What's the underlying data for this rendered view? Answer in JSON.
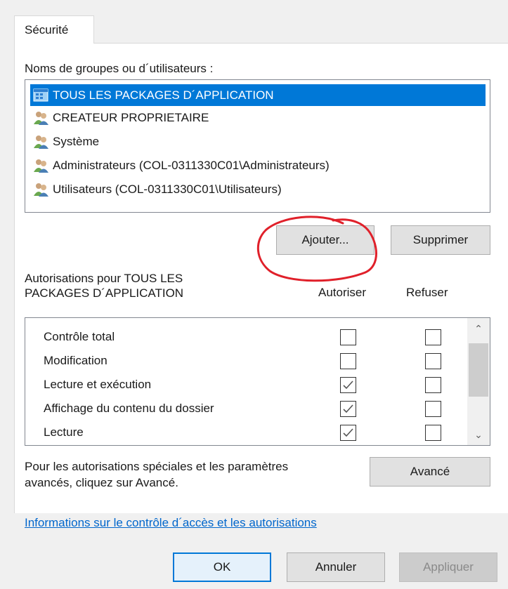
{
  "tab": {
    "label": "Sécurité"
  },
  "users": {
    "label": "Noms de groupes ou d´utilisateurs :",
    "items": [
      {
        "name": "TOUS LES PACKAGES D´APPLICATION",
        "icon": "app-package-icon",
        "selected": true
      },
      {
        "name": "CREATEUR PROPRIETAIRE",
        "icon": "user-group-icon",
        "selected": false
      },
      {
        "name": "Système",
        "icon": "user-group-icon",
        "selected": false
      },
      {
        "name": "Administrateurs (COL-0311330C01\\Administrateurs)",
        "icon": "user-group-icon",
        "selected": false
      },
      {
        "name": "Utilisateurs (COL-0311330C01\\Utilisateurs)",
        "icon": "user-group-icon",
        "selected": false
      }
    ],
    "add_label": "Ajouter...",
    "remove_label": "Supprimer"
  },
  "permissions": {
    "title_line1": "Autorisations pour TOUS LES",
    "title_line2": "PACKAGES D´APPLICATION",
    "allow_header": "Autoriser",
    "deny_header": "Refuser",
    "rows": [
      {
        "name": "Contrôle total",
        "allow": false,
        "deny": false
      },
      {
        "name": "Modification",
        "allow": false,
        "deny": false
      },
      {
        "name": "Lecture et exécution",
        "allow": true,
        "deny": false
      },
      {
        "name": "Affichage du contenu du dossier",
        "allow": true,
        "deny": false
      },
      {
        "name": "Lecture",
        "allow": true,
        "deny": false
      }
    ]
  },
  "advanced": {
    "text_line1": "Pour les autorisations spéciales et les paramètres",
    "text_line2": "avancés, cliquez sur Avancé.",
    "button_label": "Avancé"
  },
  "link": {
    "text": "Informations sur le contrôle d´accès et les autorisations"
  },
  "footer": {
    "ok_label": "OK",
    "cancel_label": "Annuler",
    "apply_label": "Appliquer"
  },
  "colors": {
    "selection": "#0078d7",
    "link": "#0066cc",
    "annotation": "#e0202a"
  }
}
